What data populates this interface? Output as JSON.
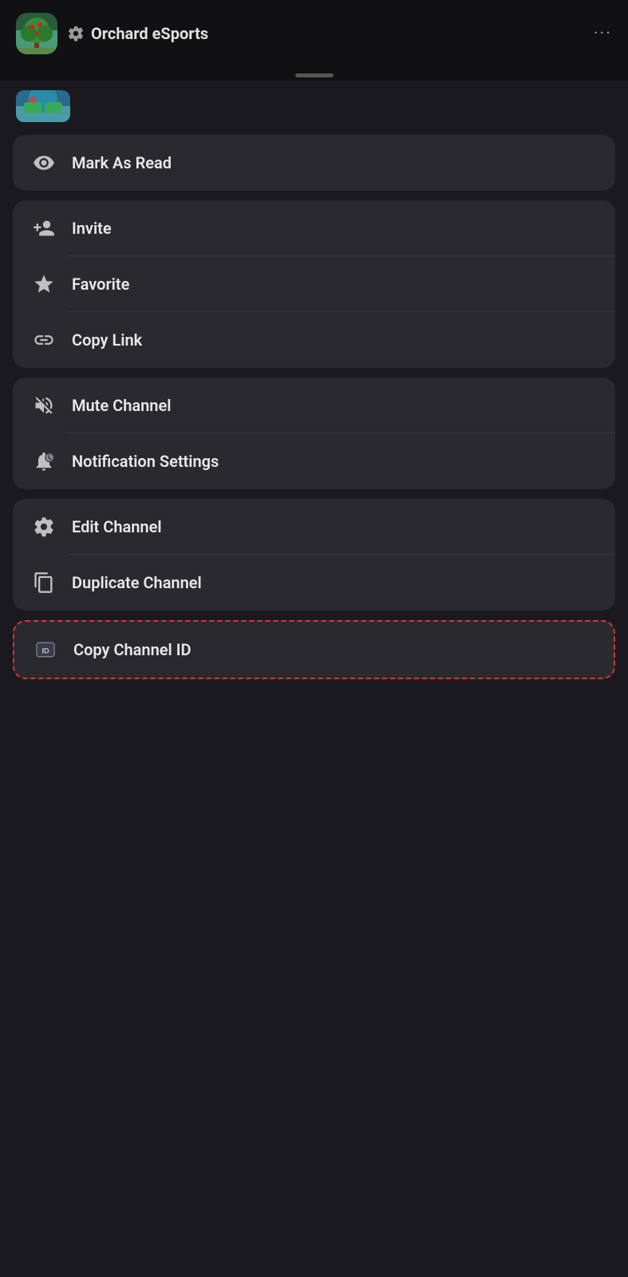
{
  "header": {
    "server_name": "Orchard eSports",
    "more_label": "···",
    "gear_aria": "server-settings-icon"
  },
  "menu_groups": [
    {
      "id": "group-read",
      "items": [
        {
          "id": "mark-as-read",
          "label": "Mark As Read",
          "icon": "eye"
        }
      ]
    },
    {
      "id": "group-actions",
      "items": [
        {
          "id": "invite",
          "label": "Invite",
          "icon": "invite"
        },
        {
          "id": "favorite",
          "label": "Favorite",
          "icon": "star"
        },
        {
          "id": "copy-link",
          "label": "Copy Link",
          "icon": "link"
        }
      ]
    },
    {
      "id": "group-notifications",
      "items": [
        {
          "id": "mute-channel",
          "label": "Mute Channel",
          "icon": "mute"
        },
        {
          "id": "notification-settings",
          "label": "Notification Settings",
          "icon": "notif"
        }
      ]
    },
    {
      "id": "group-channel-manage",
      "items": [
        {
          "id": "edit-channel",
          "label": "Edit Channel",
          "icon": "gear"
        },
        {
          "id": "duplicate-channel",
          "label": "Duplicate Channel",
          "icon": "duplicate"
        }
      ]
    }
  ],
  "highlighted_item": {
    "id": "copy-channel-id",
    "label": "Copy Channel ID",
    "icon": "id"
  }
}
